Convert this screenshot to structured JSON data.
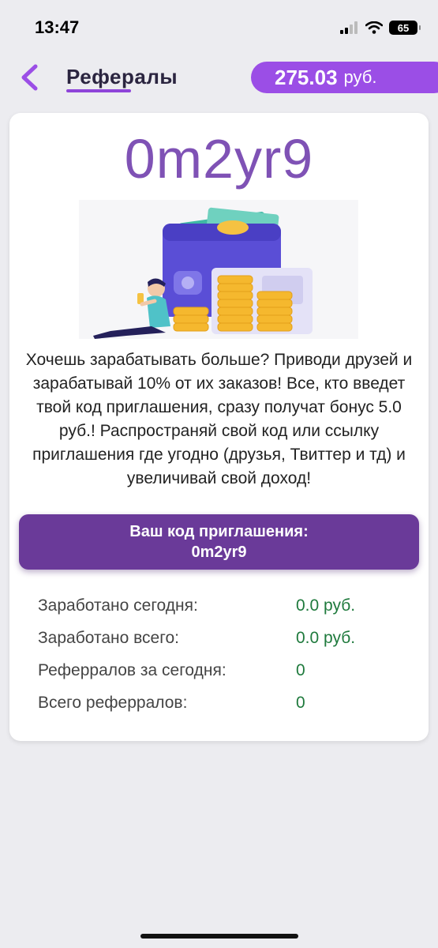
{
  "status_bar": {
    "time": "13:47",
    "battery": "65"
  },
  "header": {
    "title": "Рефералы",
    "balance_amount": "275.03",
    "balance_unit": "руб."
  },
  "card": {
    "code_display": "0m2yr9",
    "description": "Хочешь зарабатывать больше? Приводи друзей и зарабатывай 10% от их заказов! Все, кто введет твой код приглашения, сразу получат бонус 5.0 руб.! Распространяй свой код или ссылку приглашения где угодно (друзья, Твиттер и тд) и увеличивай свой доход!",
    "invite_label": "Ваш код приглашения:",
    "invite_code": "0m2yr9"
  },
  "stats": [
    {
      "label": "Заработано сегодня:",
      "value": "0.0 руб."
    },
    {
      "label": "Заработано всего:",
      "value": "0.0 руб."
    },
    {
      "label": "Реферралов за сегодня:",
      "value": "0"
    },
    {
      "label": "Всего реферралов:",
      "value": "0"
    }
  ],
  "colors": {
    "accent": "#9b4ee6",
    "code_purple": "#7f52b5",
    "invite_bg": "#6a3a99",
    "value_green": "#1f7a3d"
  }
}
